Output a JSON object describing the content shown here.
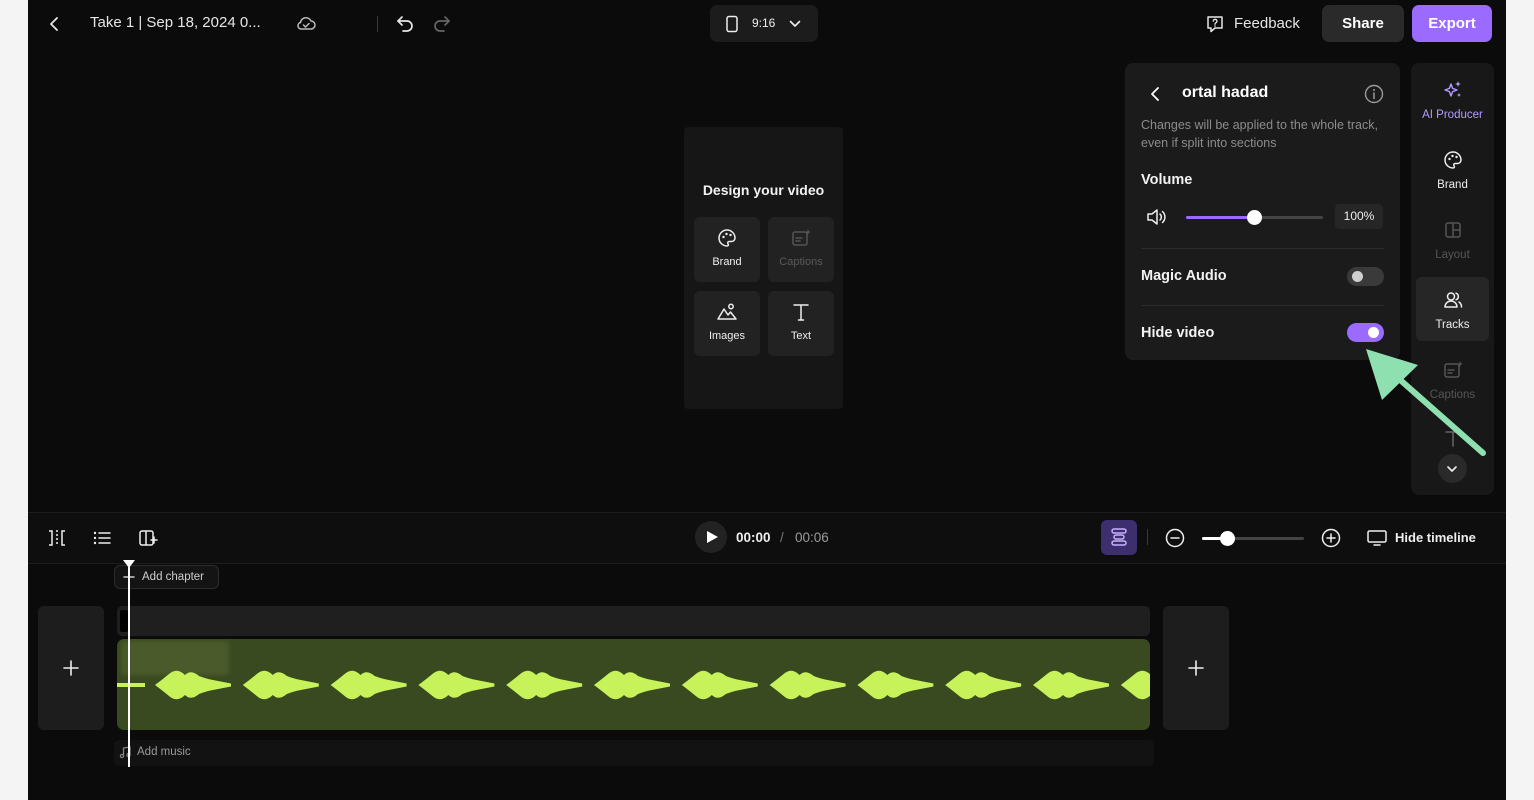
{
  "header": {
    "title": "Take 1 | Sep 18, 2024 0...",
    "aspect_ratio": "9:16",
    "feedback_label": "Feedback",
    "share_label": "Share",
    "export_label": "Export"
  },
  "design_panel": {
    "title": "Design your video",
    "tiles": [
      {
        "label": "Brand",
        "icon": "palette-icon",
        "enabled": true
      },
      {
        "label": "Captions",
        "icon": "captions-icon",
        "enabled": false
      },
      {
        "label": "Images",
        "icon": "images-icon",
        "enabled": true
      },
      {
        "label": "Text",
        "icon": "text-icon",
        "enabled": true
      }
    ]
  },
  "track_panel": {
    "name": "ortal hadad",
    "note": "Changes will be applied to the whole track, even if split into sections",
    "volume_label": "Volume",
    "volume_value": "100%",
    "volume_level": 0.5,
    "magic_audio_label": "Magic Audio",
    "magic_audio_on": false,
    "hide_video_label": "Hide video",
    "hide_video_on": true
  },
  "rail": {
    "items": [
      {
        "label": "AI Producer",
        "icon": "sparkle-icon"
      },
      {
        "label": "Brand",
        "icon": "palette-icon"
      },
      {
        "label": "Layout",
        "icon": "layout-icon"
      },
      {
        "label": "Tracks",
        "icon": "tracks-icon"
      },
      {
        "label": "Captions",
        "icon": "captions-icon"
      }
    ]
  },
  "timeline": {
    "current_time": "00:00",
    "separator": "/",
    "total_time": "00:06",
    "zoom_level": 0.25,
    "hide_timeline_label": "Hide timeline",
    "add_chapter_label": "Add chapter",
    "add_music_label": "Add music"
  },
  "colors": {
    "accent": "#9b6bff",
    "waveform": "#c8f25a",
    "arrow": "#8ee0b0"
  }
}
